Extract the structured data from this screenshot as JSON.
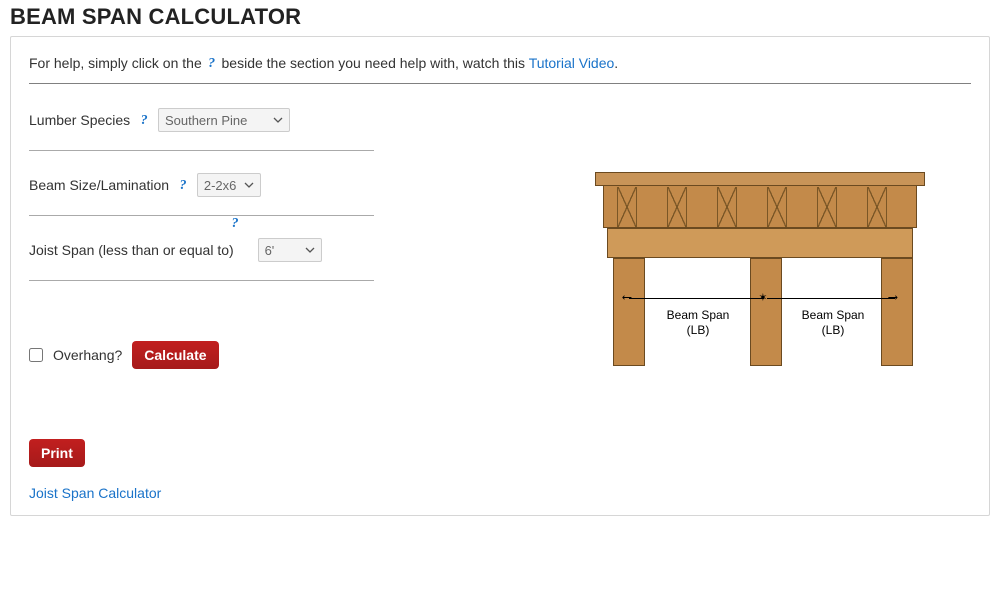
{
  "title": "BEAM SPAN CALCULATOR",
  "help": {
    "prefix": "For help, simply click on the ",
    "suffix": " beside the section you need help with, watch this ",
    "tutorial_link": "Tutorial Video",
    "period": "."
  },
  "fields": {
    "species": {
      "label": "Lumber Species",
      "value": "Southern Pine"
    },
    "beam": {
      "label": "Beam Size/Lamination",
      "value": "2-2x6"
    },
    "joist": {
      "label": "Joist Span (less than or equal to)",
      "value": "6'"
    }
  },
  "overhang": {
    "label": "Overhang?"
  },
  "buttons": {
    "calculate": "Calculate",
    "print": "Print"
  },
  "footer_link": "Joist Span Calculator",
  "diagram": {
    "span_label_1": "Beam Span\n(LB)",
    "span_label_2": "Beam Span\n(LB)"
  }
}
